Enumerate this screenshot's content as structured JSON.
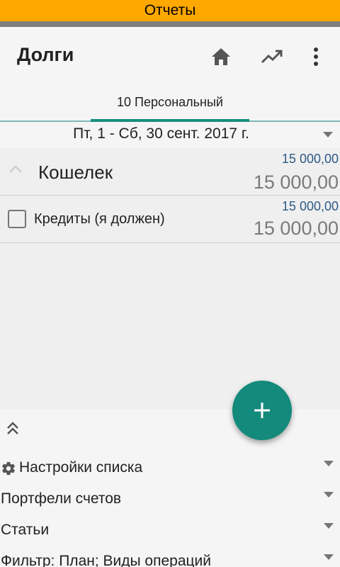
{
  "statusbar": {
    "title": "Отчеты"
  },
  "appbar": {
    "title": "Долги",
    "icons": [
      "home-icon",
      "trending-up-icon",
      "more-vertical-icon"
    ]
  },
  "tabs": [
    {
      "label": "10 Персональный",
      "active": true
    }
  ],
  "period": {
    "label": "Пт, 1 - Сб, 30 сент. 2017 г."
  },
  "list": {
    "group": {
      "name": "Кошелек",
      "amount_small": "15 000,00",
      "amount_big": "15 000,00",
      "expanded": true
    },
    "items": [
      {
        "name": "Кредиты (я должен)",
        "amount_small": "15 000,00",
        "amount_big": "15 000,00",
        "checked": false
      }
    ]
  },
  "settings": {
    "items": [
      {
        "label": "Настройки списка",
        "icon": "gear-icon"
      },
      {
        "label": "Портфели счетов"
      },
      {
        "label": "Статьи"
      },
      {
        "label": "Фильтр: План; Виды операций"
      }
    ]
  },
  "fab": {
    "icon": "plus-icon"
  },
  "colors": {
    "statusbar": "#ffa800",
    "accent": "#138a7b",
    "amount_small": "#2d5a86",
    "amount_big": "#7a7a7a"
  }
}
